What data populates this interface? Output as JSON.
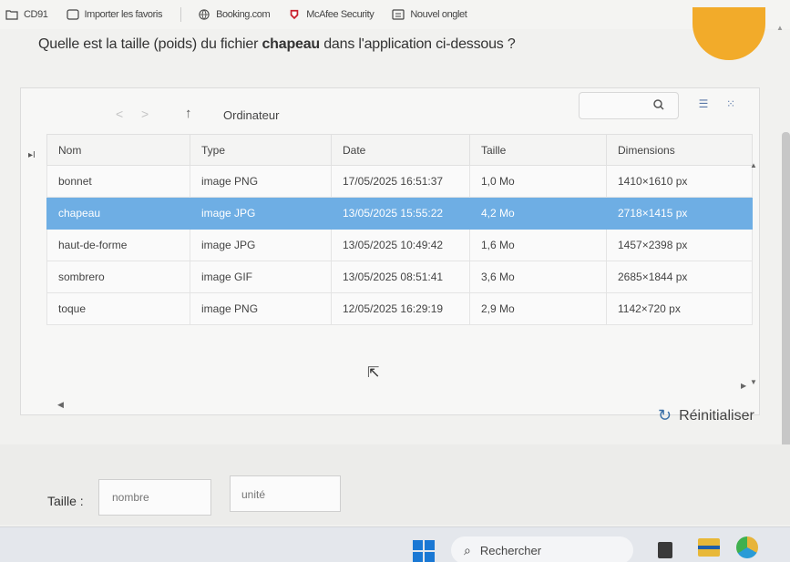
{
  "bookmarks": [
    {
      "label": "CD91",
      "icon": "folder-icon"
    },
    {
      "label": "Importer les favoris",
      "icon": "import-icon"
    },
    {
      "label": "Booking.com",
      "icon": "globe-icon"
    },
    {
      "label": "McAfee Security",
      "icon": "shield-icon"
    },
    {
      "label": "Nouvel onglet",
      "icon": "tab-icon"
    }
  ],
  "question": {
    "prefix": "Quelle est la taille (poids) du fichier ",
    "highlight": "chapeau",
    "suffix": " dans l'application ci-dessous ?"
  },
  "explorer": {
    "path": "Ordinateur",
    "columns": [
      "Nom",
      "Type",
      "Date",
      "Taille",
      "Dimensions"
    ],
    "rows": [
      {
        "name": "bonnet",
        "type": "image PNG",
        "date": "17/05/2025 16:51:37",
        "size": "1,0 Mo",
        "dims": "1410×1610 px"
      },
      {
        "name": "chapeau",
        "type": "image JPG",
        "date": "13/05/2025 15:55:22",
        "size": "4,2 Mo",
        "dims": "2718×1415 px"
      },
      {
        "name": "haut-de-forme",
        "type": "image JPG",
        "date": "13/05/2025 10:49:42",
        "size": "1,6 Mo",
        "dims": "1457×2398 px"
      },
      {
        "name": "sombrero",
        "type": "image GIF",
        "date": "13/05/2025 08:51:41",
        "size": "3,6 Mo",
        "dims": "2685×1844 px"
      },
      {
        "name": "toque",
        "type": "image PNG",
        "date": "12/05/2025 16:29:19",
        "size": "2,9 Mo",
        "dims": "1142×720 px"
      }
    ],
    "selected_row": 1
  },
  "reset": {
    "label": "Réinitialiser"
  },
  "answer": {
    "label": "Taille :",
    "number_placeholder": "nombre",
    "unit_placeholder": "unité"
  },
  "taskbar": {
    "search_label": "Rechercher"
  }
}
